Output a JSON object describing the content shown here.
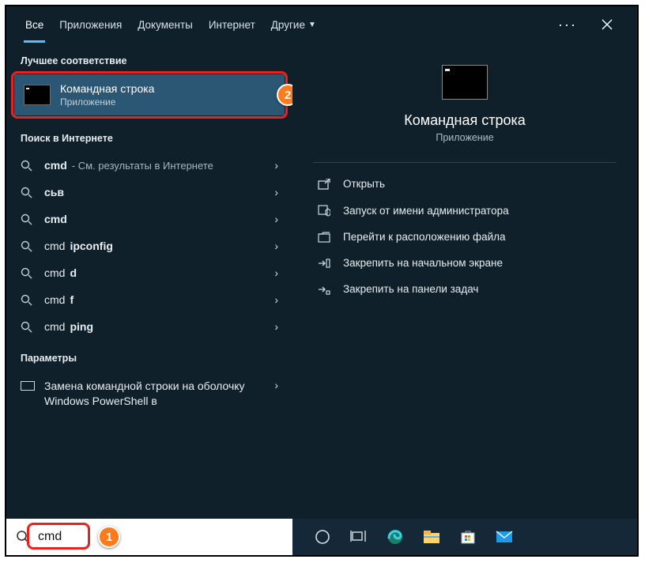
{
  "tabs": {
    "all": "Все",
    "apps": "Приложения",
    "docs": "Документы",
    "web": "Интернет",
    "other": "Другие"
  },
  "left": {
    "best_match_h": "Лучшее соответствие",
    "best_title": "Командная строка",
    "best_sub": "Приложение",
    "web_h": "Поиск в Интернете",
    "rows": [
      {
        "bold": "cmd",
        "sub": "- См. результаты в Интернете"
      },
      {
        "bold": "сьв",
        "sub": ""
      },
      {
        "bold": "cmd",
        "sub": ""
      },
      {
        "plain": "cmd ",
        "bold": "ipconfig",
        "sub": ""
      },
      {
        "plain": "cmd",
        "bold": "d",
        "sub": ""
      },
      {
        "plain": "cmd",
        "bold": "f",
        "sub": ""
      },
      {
        "plain": "cmd ",
        "bold": "ping",
        "sub": ""
      }
    ],
    "params_h": "Параметры",
    "setting_text": "Замена командной строки на оболочку Windows PowerShell в"
  },
  "right": {
    "title": "Командная строка",
    "sub": "Приложение",
    "actions": {
      "open": "Открыть",
      "admin": "Запуск от имени администратора",
      "loc": "Перейти к расположению файла",
      "pin_start": "Закрепить на начальном экране",
      "pin_task": "Закрепить на панели задач"
    }
  },
  "badges": {
    "one": "1",
    "two": "2"
  },
  "search": {
    "value": "cmd"
  }
}
